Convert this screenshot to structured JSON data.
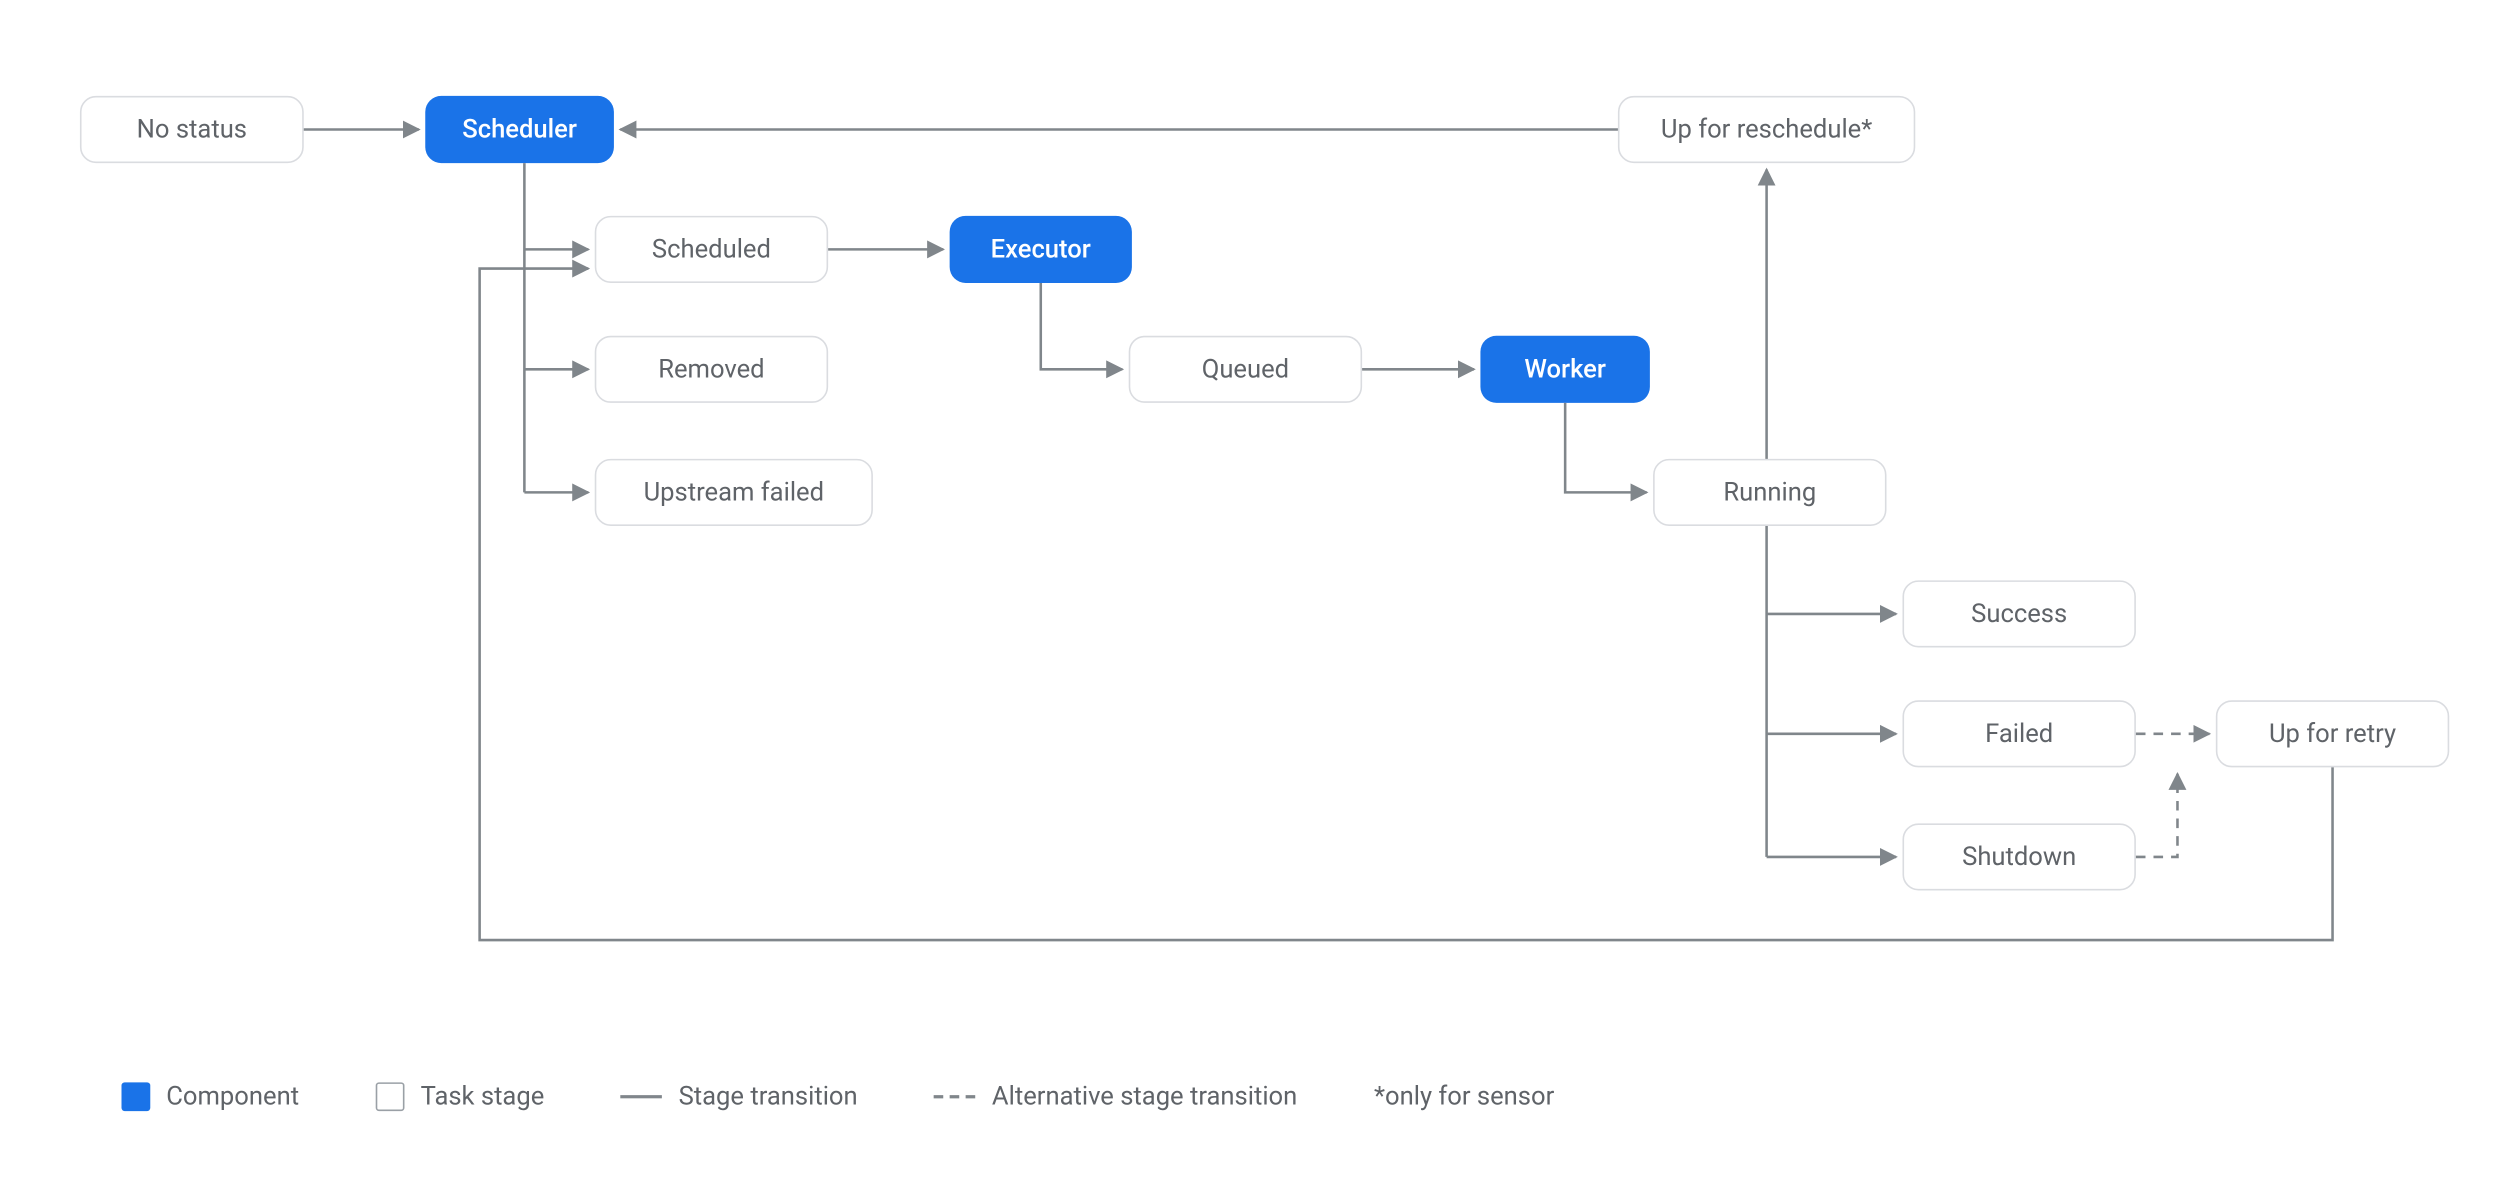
{
  "nodes": {
    "noStatus": {
      "label": "No status",
      "type": "stage"
    },
    "scheduler": {
      "label": "Scheduler",
      "type": "component"
    },
    "scheduled": {
      "label": "Scheduled",
      "type": "stage"
    },
    "removed": {
      "label": "Removed",
      "type": "stage"
    },
    "upstreamFailed": {
      "label": "Upstream failed",
      "type": "stage"
    },
    "executor": {
      "label": "Executor",
      "type": "component"
    },
    "queued": {
      "label": "Queued",
      "type": "stage"
    },
    "worker": {
      "label": "Worker",
      "type": "component"
    },
    "running": {
      "label": "Running",
      "type": "stage"
    },
    "success": {
      "label": "Success",
      "type": "stage"
    },
    "failed": {
      "label": "Failed",
      "type": "stage"
    },
    "shutdown": {
      "label": "Shutdown",
      "type": "stage"
    },
    "upForRetry": {
      "label": "Up for retry",
      "type": "stage"
    },
    "upForReschedule": {
      "label": "Up for reschedule*",
      "type": "stage"
    }
  },
  "edges": [
    {
      "from": "noStatus",
      "to": "scheduler",
      "style": "solid"
    },
    {
      "from": "scheduler",
      "to": "scheduled",
      "style": "solid"
    },
    {
      "from": "scheduler",
      "to": "removed",
      "style": "solid"
    },
    {
      "from": "scheduler",
      "to": "upstreamFailed",
      "style": "solid"
    },
    {
      "from": "scheduled",
      "to": "executor",
      "style": "solid"
    },
    {
      "from": "executor",
      "to": "queued",
      "style": "solid"
    },
    {
      "from": "queued",
      "to": "worker",
      "style": "solid"
    },
    {
      "from": "worker",
      "to": "running",
      "style": "solid"
    },
    {
      "from": "running",
      "to": "success",
      "style": "solid"
    },
    {
      "from": "running",
      "to": "failed",
      "style": "solid"
    },
    {
      "from": "running",
      "to": "shutdown",
      "style": "solid"
    },
    {
      "from": "running",
      "to": "upForReschedule",
      "style": "solid"
    },
    {
      "from": "upForReschedule",
      "to": "scheduler",
      "style": "solid"
    },
    {
      "from": "failed",
      "to": "upForRetry",
      "style": "dashed"
    },
    {
      "from": "shutdown",
      "to": "upForRetry",
      "style": "dashed"
    },
    {
      "from": "upForRetry",
      "to": "scheduled",
      "style": "solid"
    }
  ],
  "legend": {
    "component": "Component",
    "taskStage": "Task stage",
    "stageTransition": "Stage transition",
    "altTransition": "Alternative stage transition",
    "note": "*only for sensor"
  },
  "colors": {
    "accent": "#1a73e8",
    "border": "#dadce0",
    "text": "#5f6368",
    "line": "#80868b"
  }
}
